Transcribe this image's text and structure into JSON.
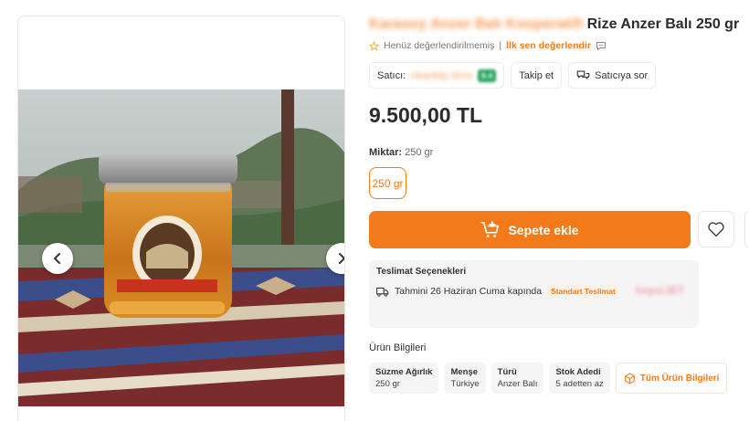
{
  "product": {
    "title_blurred": "Karasoy Anzer Balı Kooperatifi",
    "title": "Rize Anzer Balı 250 gr",
    "price": "9.500,00 TL"
  },
  "rating": {
    "not_rated": "Henüz değerlendirilmemiş",
    "rate_first": "İlk sen değerlendir"
  },
  "seller": {
    "label": "Satıcı:",
    "name": "cleanbig store",
    "score": "9.4",
    "follow": "Takip et",
    "ask": "Satıcıya sor"
  },
  "amount": {
    "label": "Miktar:",
    "value": "250 gr",
    "options": [
      "250 gr"
    ]
  },
  "cart": {
    "add_label": "Sepete ekle"
  },
  "delivery": {
    "title": "Teslimat Seçenekleri",
    "estimate": "Tahmini 26 Haziran Cuma kapında",
    "badge": "Standart Teslimat",
    "carrier": "hepsiJET"
  },
  "info": {
    "title": "Ürün Bilgileri",
    "cards": [
      {
        "key": "Süzme Ağırlık",
        "value": "250 gr"
      },
      {
        "key": "Menşe",
        "value": "Türkiye"
      },
      {
        "key": "Türü",
        "value": "Anzer Balı"
      },
      {
        "key": "Stok Adedi",
        "value": "5 adetten az"
      }
    ],
    "all_label": "Tüm Ürün Bilgileri"
  },
  "colors": {
    "accent": "#f27a1a",
    "text": "#2b2b2b",
    "panel": "#f5f5f5"
  }
}
